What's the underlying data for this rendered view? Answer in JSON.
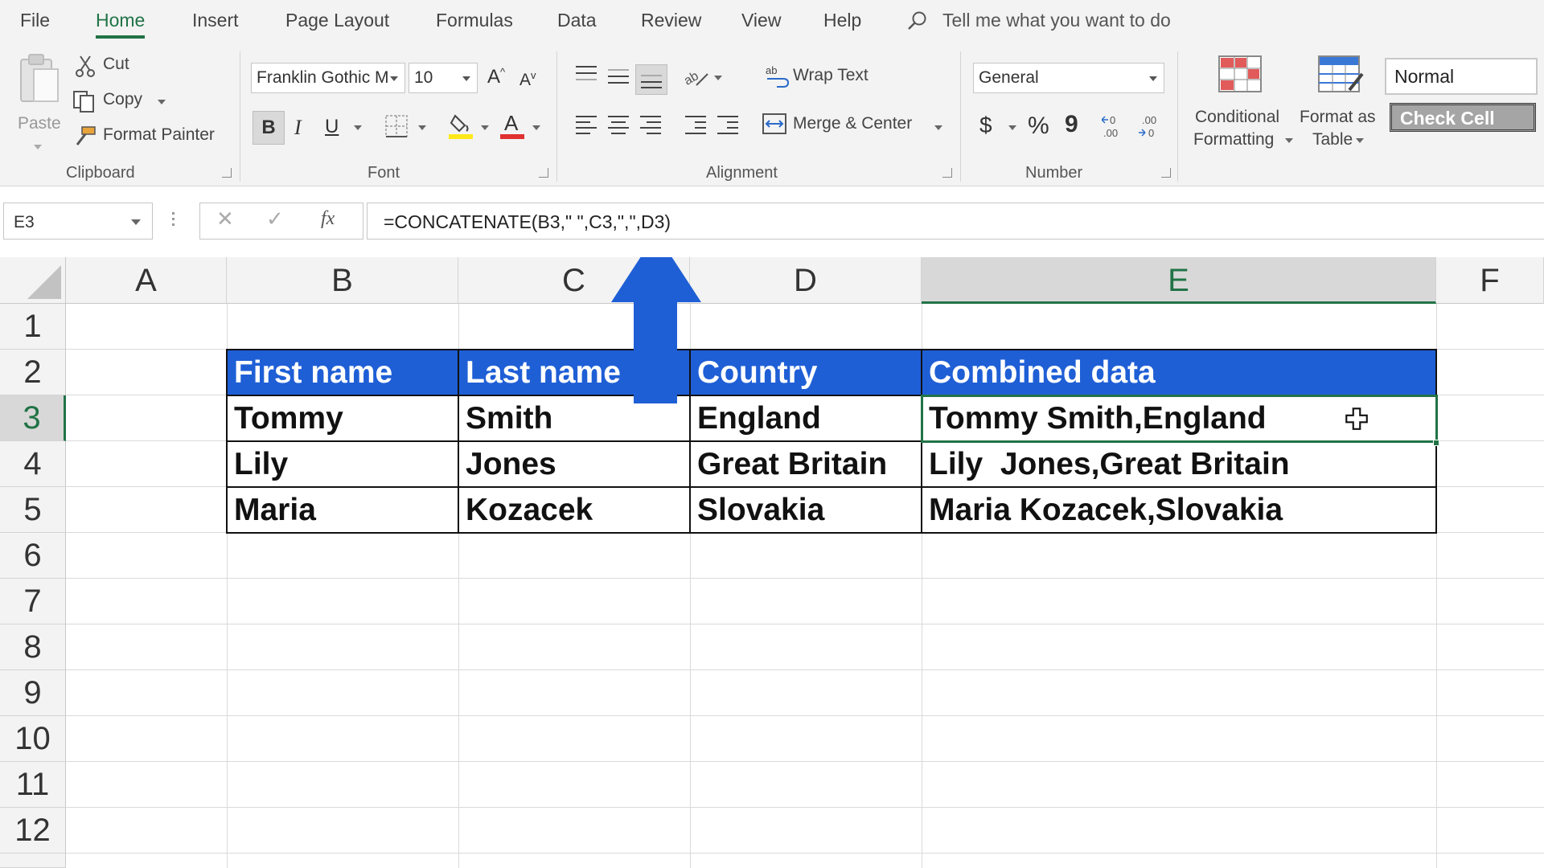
{
  "menu": {
    "tabs": [
      "File",
      "Home",
      "Insert",
      "Page Layout",
      "Formulas",
      "Data",
      "Review",
      "View",
      "Help"
    ],
    "tell_me": "Tell me what you want to do"
  },
  "ribbon": {
    "clipboard": {
      "paste": "Paste",
      "cut": "Cut",
      "copy": "Copy",
      "format_painter": "Format Painter",
      "label": "Clipboard"
    },
    "font": {
      "family": "Franklin Gothic M",
      "size": "10",
      "bold": "B",
      "italic": "I",
      "underline": "U",
      "label": "Font",
      "grow": "A",
      "shrink": "A"
    },
    "alignment": {
      "wrap_text": "Wrap Text",
      "merge_center": "Merge & Center",
      "label": "Alignment"
    },
    "number": {
      "format": "General",
      "currency": "$",
      "percent": "%",
      "comma": "9",
      "label": "Number"
    },
    "styles": {
      "conditional_1": "Conditional",
      "conditional_2": "Formatting",
      "format_as_1": "Format as",
      "format_as_2": "Table",
      "normal": "Normal",
      "check_cell": "Check Cell"
    }
  },
  "formula_bar": {
    "name_box": "E3",
    "formula": "=CONCATENATE(B3,\" \",C3,\",\",D3)",
    "fx": "fx"
  },
  "sheet": {
    "columns": [
      "A",
      "B",
      "C",
      "D",
      "E",
      "F"
    ],
    "rows": [
      "1",
      "2",
      "3",
      "4",
      "5",
      "6",
      "7",
      "8",
      "9",
      "10",
      "11",
      "12"
    ],
    "table": {
      "headers": [
        "First name",
        "Last name",
        "Country",
        "Combined data"
      ],
      "rows": [
        [
          "Tommy",
          "Smith",
          "England",
          "Tommy Smith,England"
        ],
        [
          "Lily",
          "Jones",
          "Great Britain",
          "Lily  Jones,Great Britain"
        ],
        [
          "Maria",
          "Kozacek",
          "Slovakia",
          "Maria Kozacek,Slovakia"
        ]
      ]
    }
  },
  "colors": {
    "accent": "#217346",
    "table_header": "#1f5fd6",
    "arrow": "#1f5fd6"
  }
}
